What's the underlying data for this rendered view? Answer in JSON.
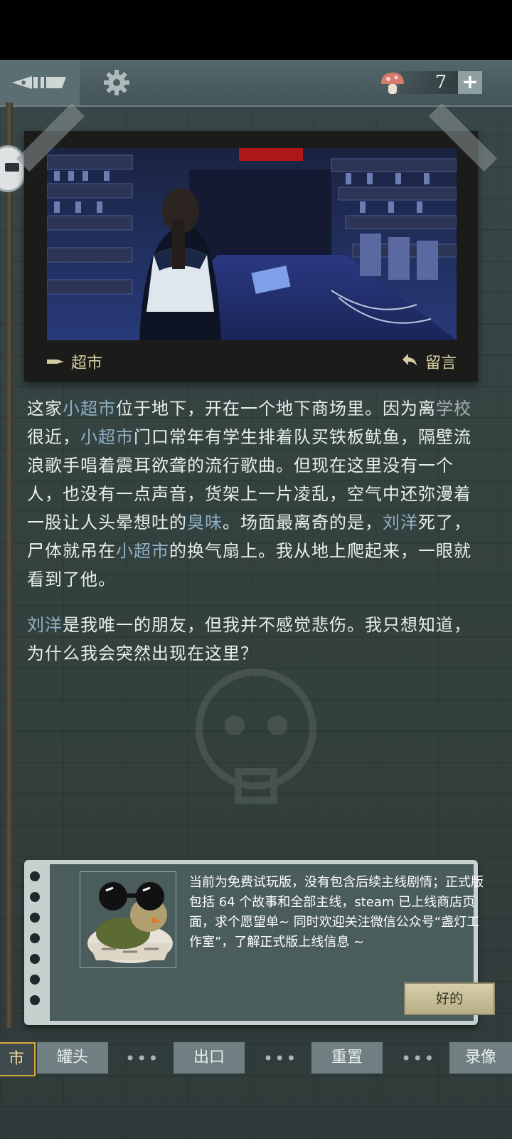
{
  "topbar": {
    "mushroom_count": "7",
    "add_label": "+"
  },
  "scene_card": {
    "location": "超市",
    "message": "留言"
  },
  "story": {
    "p1": [
      {
        "t": "这家",
        "k": ""
      },
      {
        "t": "小超市",
        "k": "kw"
      },
      {
        "t": "位于地下，开在一个地下商场里。因为离",
        "k": ""
      },
      {
        "t": "学校",
        "k": "kw2"
      },
      {
        "t": "很近，",
        "k": ""
      },
      {
        "t": "小超市",
        "k": "kw"
      },
      {
        "t": "门口常年有学生排着队买铁板鱿鱼，隔壁流浪歌手唱着震耳欲聋的流行歌曲。但现在这里没有一个人，也没有一点声音，货架上一片凌乱，空气中还弥漫着一股让人头晕想吐的",
        "k": ""
      },
      {
        "t": "臭味",
        "k": "kw"
      },
      {
        "t": "。场面最离奇的是，",
        "k": ""
      },
      {
        "t": "刘洋",
        "k": "kw"
      },
      {
        "t": "死了，尸体就吊在",
        "k": ""
      },
      {
        "t": "小超市",
        "k": "kw"
      },
      {
        "t": "的换气扇上。我从地上爬起来，一眼就看到了他。",
        "k": ""
      }
    ],
    "p2": [
      {
        "t": "刘洋",
        "k": "kw"
      },
      {
        "t": "是我唯一的朋友，但我并不感觉悲伤。我只想知道，为什么我会突然出现在这里？",
        "k": ""
      }
    ]
  },
  "notice": {
    "text": "当前为免费试玩版，没有包含后续主线剧情；正式版包括 64 个故事和全部主线，steam 已上线商店页面，求个愿望单~ 同时欢迎关注微信公众号“盏灯工作室”，了解正式版上线信息 ~",
    "ok_label": "好的"
  },
  "bottom_nav": {
    "tab_supermarket": "市",
    "tab_can": "罐头",
    "tab_exit": "出口",
    "tab_reset": "重置",
    "tab_video": "录像",
    "dots": "•••"
  }
}
